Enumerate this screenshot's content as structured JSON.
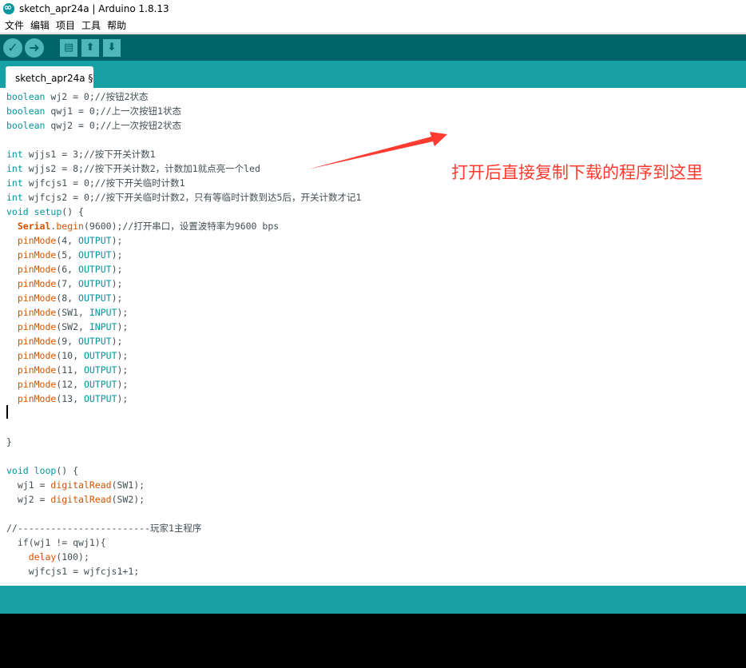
{
  "window": {
    "title": "sketch_apr24a | Arduino 1.8.13"
  },
  "menu": {
    "items": [
      "文件",
      "编辑",
      "项目",
      "工具",
      "帮助"
    ]
  },
  "toolbar": {
    "verify_icon": "✓",
    "upload_icon": "➜",
    "new_icon": "▤",
    "open_icon": "⬆",
    "save_icon": "⬇"
  },
  "tab": {
    "label": "sketch_apr24a §"
  },
  "annotation": {
    "text": "打开后直接复制下载的程序到这里"
  },
  "code": {
    "lines": [
      "boolean wj2 = 0;//按钮2状态",
      "boolean qwj1 = 0;//上一次按钮1状态",
      "boolean qwj2 = 0;//上一次按钮2状态",
      "",
      "int wjjs1 = 3;//按下开关计数1",
      "int wjjs2 = 8;//按下开关计数2，计数加1就点亮一个led",
      "int wjfcjs1 = 0;//按下开关临时计数1",
      "int wjfcjs2 = 0;//按下开关临时计数2，只有等临时计数到达5后，开关计数才记1",
      "void setup() {",
      "  Serial.begin(9600);//打开串口，设置波特率为9600 bps",
      "  pinMode(4, OUTPUT);",
      "  pinMode(5, OUTPUT);",
      "  pinMode(6, OUTPUT);",
      "  pinMode(7, OUTPUT);",
      "  pinMode(8, OUTPUT);",
      "  pinMode(SW1, INPUT);",
      "  pinMode(SW2, INPUT);",
      "  pinMode(9, OUTPUT);",
      "  pinMode(10, OUTPUT);",
      "  pinMode(11, OUTPUT);",
      "  pinMode(12, OUTPUT);",
      "  pinMode(13, OUTPUT);",
      "",
      "",
      "}",
      "",
      "void loop() {",
      "  wj1 = digitalRead(SW1);",
      "  wj2 = digitalRead(SW2);",
      "",
      "//------------------------玩家1主程序",
      "  if(wj1 != qwj1){",
      "    delay(100);",
      "    wjfcjs1 = wjfcjs1+1;"
    ]
  },
  "colors": {
    "toolbar": "#006468",
    "tabbar": "#17a1a5",
    "annotation": "#ff3b30",
    "keyword": "#00979c",
    "function": "#d35400"
  }
}
